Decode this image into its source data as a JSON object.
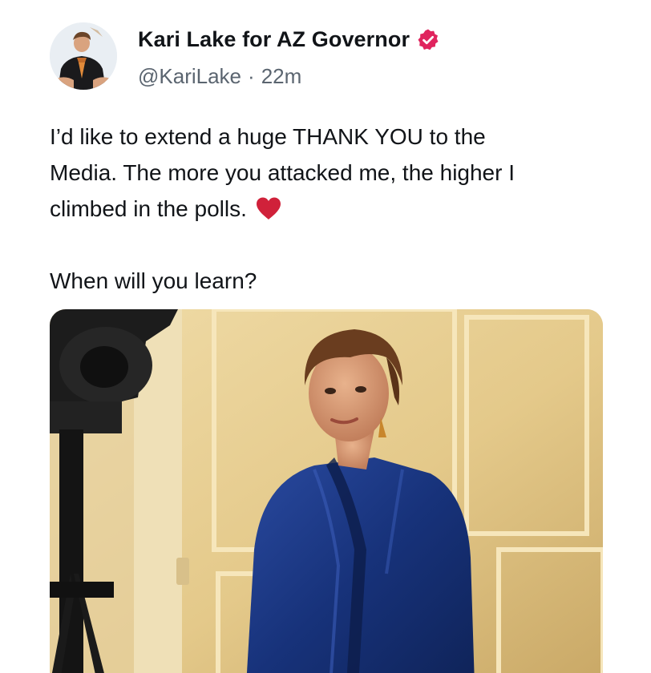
{
  "tweet": {
    "author": {
      "display_name": "Kari Lake for AZ Governor",
      "handle": "@KariLake",
      "verified_icon": "verified-badge-icon",
      "verified_color": "#e0245e"
    },
    "separator": "·",
    "timestamp": "22m",
    "text": {
      "line1": "I’d like to extend a huge THANK YOU to the",
      "line2": "Media. The more you attacked me, the higher I",
      "line3": "climbed in the polls.",
      "paragraph2": "When will you learn?"
    },
    "emoji": {
      "name": "red-heart-icon",
      "color": "#d0213a"
    },
    "media": {
      "type": "photo",
      "icon": "photo-media"
    }
  }
}
